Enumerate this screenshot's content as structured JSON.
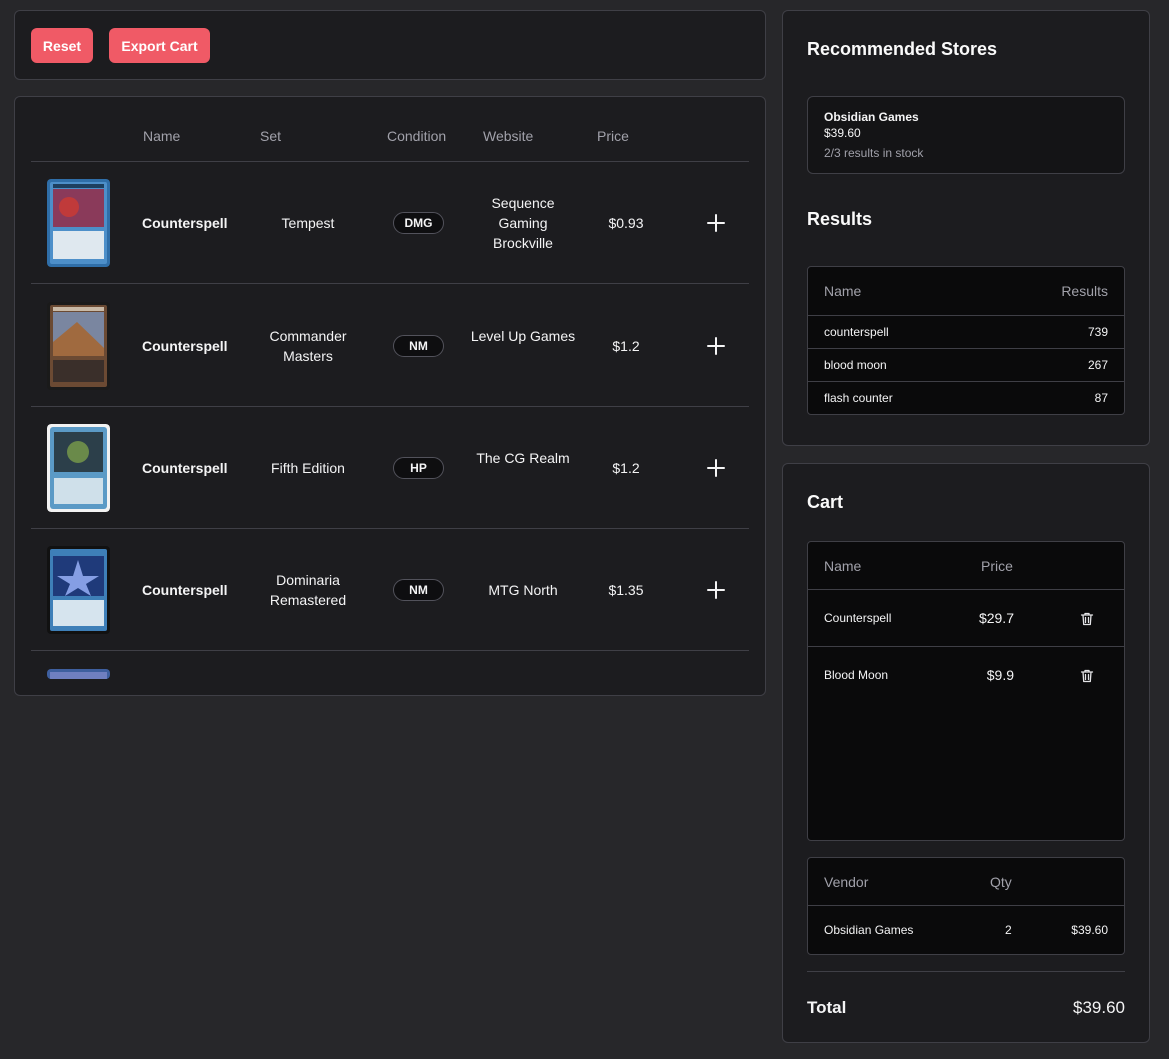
{
  "toolbar": {
    "reset_label": "Reset",
    "export_label": "Export Cart"
  },
  "results_table": {
    "headers": {
      "name": "Name",
      "set": "Set",
      "condition": "Condition",
      "website": "Website",
      "price": "Price"
    },
    "rows": [
      {
        "name": "Counterspell",
        "set": "Tempest",
        "condition": "DMG",
        "website": "Sequence Gaming Brockville",
        "price": "$0.93"
      },
      {
        "name": "Counterspell",
        "set": "Commander Masters",
        "condition": "NM",
        "website": "Level Up Games",
        "price": "$1.2"
      },
      {
        "name": "Counterspell",
        "set": "Fifth Edition",
        "condition": "HP",
        "website": "The CG Realm",
        "price": "$1.2"
      },
      {
        "name": "Counterspell",
        "set": "Dominaria Remastered",
        "condition": "NM",
        "website": "MTG North",
        "price": "$1.35"
      }
    ]
  },
  "recommended": {
    "title": "Recommended Stores",
    "store": {
      "name": "Obsidian Games",
      "price": "$39.60",
      "stock": "2/3 results in stock"
    }
  },
  "results_summary": {
    "title": "Results",
    "headers": {
      "name": "Name",
      "results": "Results"
    },
    "rows": [
      {
        "name": "counterspell",
        "results": "739"
      },
      {
        "name": "blood moon",
        "results": "267"
      },
      {
        "name": "flash counter",
        "results": "87"
      }
    ]
  },
  "cart": {
    "title": "Cart",
    "headers": {
      "name": "Name",
      "price": "Price"
    },
    "items": [
      {
        "name": "Counterspell",
        "price": "$29.7"
      },
      {
        "name": "Blood Moon",
        "price": "$9.9"
      }
    ],
    "vendor_headers": {
      "vendor": "Vendor",
      "qty": "Qty"
    },
    "vendors": [
      {
        "vendor": "Obsidian Games",
        "qty": "2",
        "amount": "$39.60"
      }
    ],
    "total_label": "Total",
    "total_value": "$39.60"
  },
  "colors": {
    "accent": "#f05a66",
    "background": "#27272a",
    "panel": "#1c1c1f"
  },
  "icons": [
    "plus-icon",
    "trash-icon",
    "card-art-image"
  ]
}
